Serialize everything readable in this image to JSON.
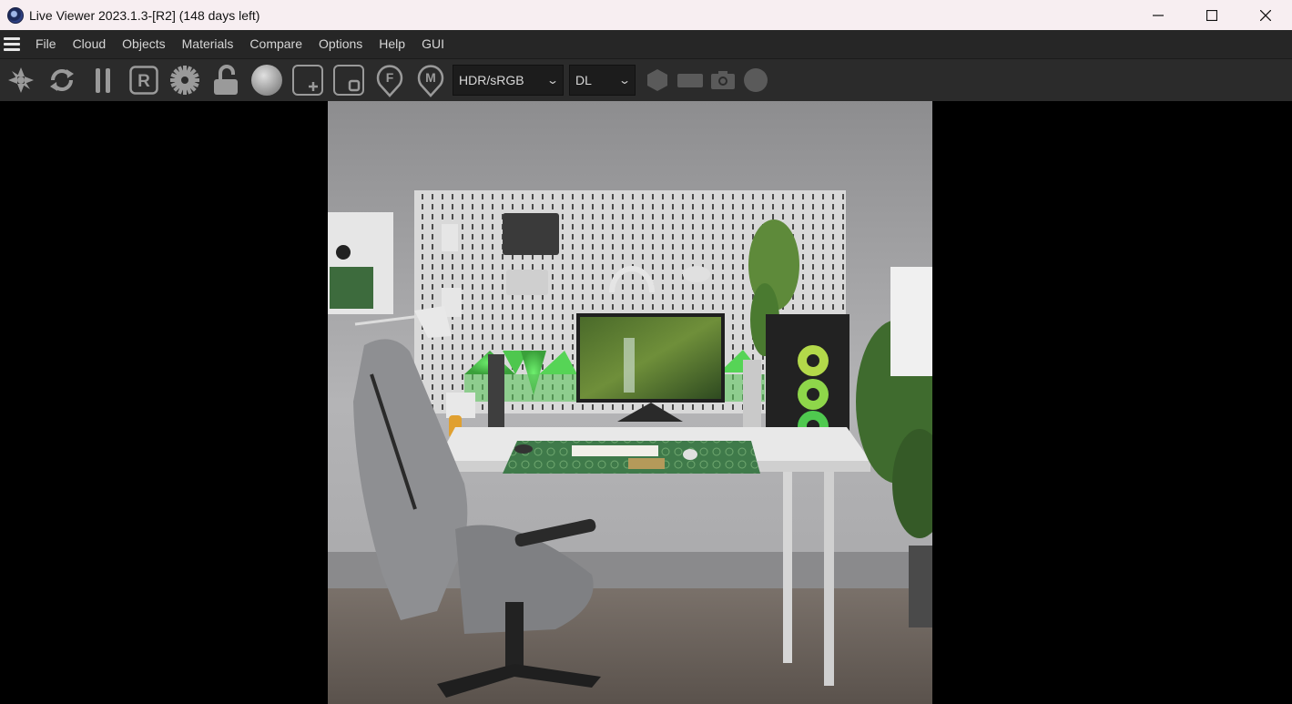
{
  "window": {
    "title": "Live Viewer 2023.1.3-[R2] (148 days left)",
    "app_icon": "cinema4d-icon",
    "controls": [
      "minimize-icon",
      "maximize-icon",
      "close-icon"
    ]
  },
  "menu": {
    "items": [
      "File",
      "Cloud",
      "Objects",
      "Materials",
      "Compare",
      "Options",
      "Help",
      "GUI"
    ]
  },
  "toolbar": {
    "icons": [
      "reset-render-icon",
      "refresh-icon",
      "pause-icon",
      "region-r-icon",
      "settings-gear-icon",
      "lock-icon",
      "material-sphere-icon",
      "add-region-icon",
      "clay-mode-icon",
      "focus-pick-icon",
      "material-pick-icon"
    ],
    "color_space": {
      "value": "HDR/sRGB"
    },
    "kernel": {
      "value": "DL"
    },
    "shape_icons": [
      "hexagon-icon",
      "rectangle-icon",
      "camera-icon",
      "circle-icon"
    ]
  },
  "colors": {
    "titlebar_bg": "#f7eef1",
    "menubar_bg": "#262626",
    "toolbar_bg": "#2b2b2b",
    "icon_gray": "#9a9a9a",
    "accent_green": "#4cd14c"
  },
  "render": {
    "description_hidden": true,
    "scene": "desk-setup-render"
  }
}
